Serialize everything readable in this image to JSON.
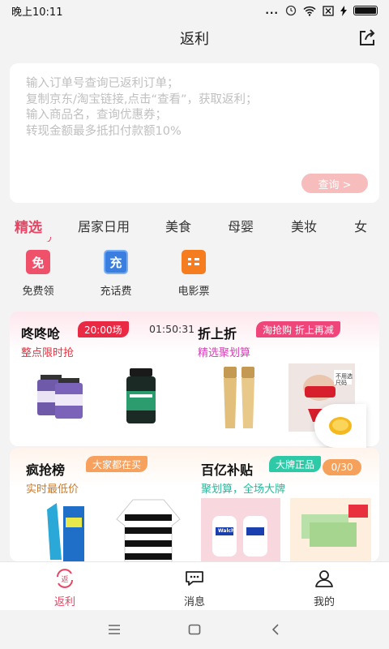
{
  "status": {
    "time": "晚上10:11",
    "dots": "...",
    "icons": [
      "alarm-icon",
      "wifi-icon",
      "sim-x-icon",
      "charging-icon",
      "battery-icon"
    ]
  },
  "header": {
    "title": "返利",
    "share_icon": "share-icon"
  },
  "query": {
    "hint_lines": [
      "输入订单号查询已返利订单；",
      "复制京东/淘宝链接,点击“查看”，获取返利；",
      "输入商品名，查询优惠券；",
      "转现金额最多抵扣付款额10%"
    ],
    "button": "查询 >"
  },
  "tabs": [
    "精选",
    "居家日用",
    "美食",
    "母婴",
    "美妆",
    "女"
  ],
  "quick": [
    {
      "glyph": "免",
      "label": "免费领",
      "color": "#f0516a",
      "icon": "free-icon"
    },
    {
      "glyph": "充",
      "label": "充话费",
      "color": "#3a7fe0",
      "icon": "phone-topup-icon"
    },
    {
      "glyph": "",
      "label": "电影票",
      "color": "#f57c1f",
      "icon": "movie-ticket-icon"
    }
  ],
  "promos": {
    "dongdong": {
      "title": "咚咚呛",
      "badge": "20:00场",
      "countdown": "01:50:31",
      "sub": "整点限时抢",
      "badge_color": "#ea2a44",
      "sub_color": "#e8303f"
    },
    "zheshangzhe": {
      "title": "折上折",
      "badge": "淘抢购 折上再减",
      "sub": "精选聚划算",
      "badge_color": "#f0457a",
      "sub_color": "#d83db9"
    },
    "fengqiang": {
      "title": "疯抢榜",
      "badge": "大家都在买",
      "sub": "实时最低价",
      "badge_color": "#f6a25e",
      "sub_color": "#c97a28"
    },
    "baiyi": {
      "title": "百亿补贴",
      "badge": "大牌正品",
      "sub": "聚划算，全场大牌",
      "badge_color": "#2ec9a6",
      "sub_color": "#2ab79a"
    }
  },
  "products": {
    "walch_brand": "Walch",
    "tag_text": "不用选尺码"
  },
  "progress": "0/30",
  "bottom_nav": [
    {
      "label": "返利",
      "icon": "rebate-icon",
      "active": true
    },
    {
      "label": "消息",
      "icon": "message-icon",
      "active": false
    },
    {
      "label": "我的",
      "icon": "profile-icon",
      "active": false
    }
  ],
  "colors": {
    "accent": "#e84463",
    "background": "#f3f3f3"
  }
}
